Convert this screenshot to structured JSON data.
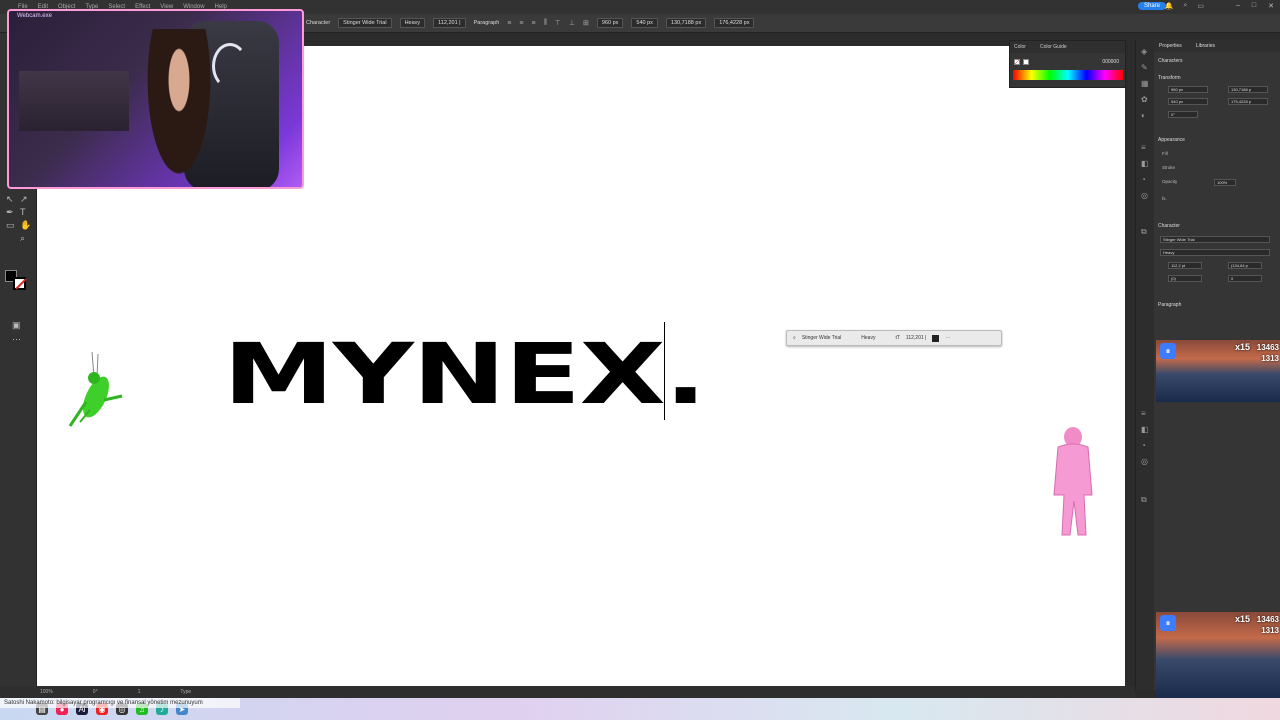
{
  "menubar": {
    "items": [
      "File",
      "Edit",
      "Object",
      "Type",
      "Select",
      "Effect",
      "View",
      "Window",
      "Help"
    ],
    "share_label": "Share"
  },
  "control_bar": {
    "character_label": "Character",
    "font_family": "Stinger Wide Trial",
    "font_style": "Heavy",
    "font_size": "112,201 |",
    "paragraph_label": "Paragraph",
    "x_value": "960 px",
    "y_value": "540 px",
    "w_value": "130,7188 px",
    "h_value": "176,4228 px"
  },
  "canvas": {
    "text": "MYNEX."
  },
  "context_bar": {
    "font_family": "Stinger Wide Trial",
    "font_style": "Heavy",
    "font_size": "112,201 |"
  },
  "color_panel": {
    "tabs": [
      "Color",
      "Color Guide"
    ],
    "hex": "000000"
  },
  "properties": {
    "tabs": [
      "Properties",
      "Libraries"
    ],
    "object_type": "Characters",
    "transform_label": "Transform",
    "x": "960 px",
    "y": "540 px",
    "w": "130,7188 p",
    "h": "175,4228 p",
    "angle": "0°",
    "appearance_label": "Appearance",
    "fill_label": "Fill",
    "stroke_label": "Stroke",
    "opacity_label": "Opacity",
    "opacity_value": "100%",
    "fx_label": "fx.",
    "character_label": "Character",
    "font_family": "Stinger Wide Trial",
    "font_style": "Heavy",
    "font_size": "112,2 pt",
    "leading": "(134,64 p",
    "tracking": "(0)",
    "kerning": "0",
    "paragraph_label": "Paragraph"
  },
  "webcam": {
    "label": "Webcam.exe"
  },
  "game_overlay": {
    "multiplier": "x15",
    "score_top": "13463",
    "score_bottom": "1313"
  },
  "statusbar": {
    "zoom": "100%",
    "angle": "0°",
    "page": "1",
    "tool": "Type"
  },
  "ticker": {
    "text": "Satoshi Nakamoto: bilgisayar programcıgı ve finansal yönetim mezunuyum"
  }
}
